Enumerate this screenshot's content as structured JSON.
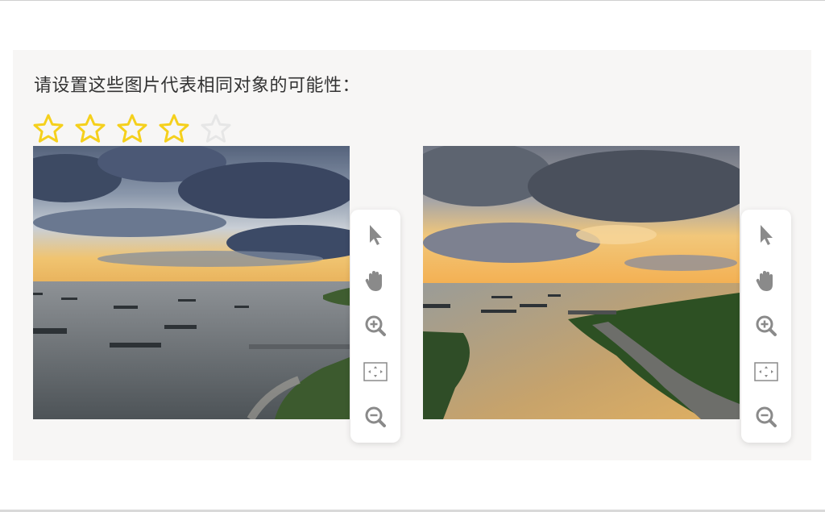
{
  "prompt": {
    "text": "请设置这些图片代表相同对象的可能性："
  },
  "rating": {
    "value": 4,
    "max": 5,
    "filled_color": "#f5d01c",
    "empty_color": "#e6e6e6"
  },
  "images": [
    {
      "name": "left-image",
      "icon": "river-landscape-photo"
    },
    {
      "name": "right-image",
      "icon": "river-sunset-photo"
    }
  ],
  "toolbar": {
    "tools": [
      "pointer-icon",
      "hand-icon",
      "zoom-in-icon",
      "fit-screen-icon",
      "zoom-out-icon"
    ],
    "icon_color": "#8a8a8a"
  }
}
